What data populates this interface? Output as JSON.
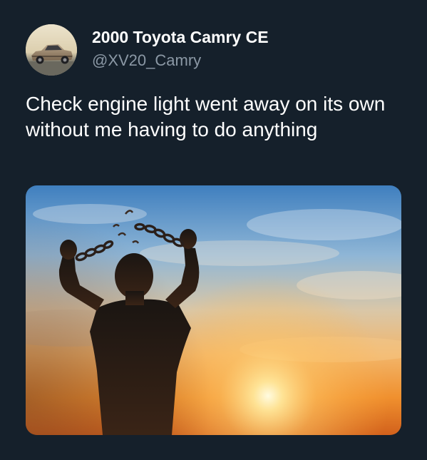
{
  "tweet": {
    "author": {
      "display_name": "2000 Toyota Camry CE",
      "handle": "@XV20_Camry",
      "avatar_icon": "car-photo-avatar"
    },
    "text": "Check engine light went away on its own without me having to do anything",
    "media": {
      "icon": "man-breaking-chains-at-sunset-photo"
    }
  },
  "colors": {
    "background": "#15202b",
    "text_primary": "#ffffff",
    "text_secondary": "#8b98a5"
  }
}
